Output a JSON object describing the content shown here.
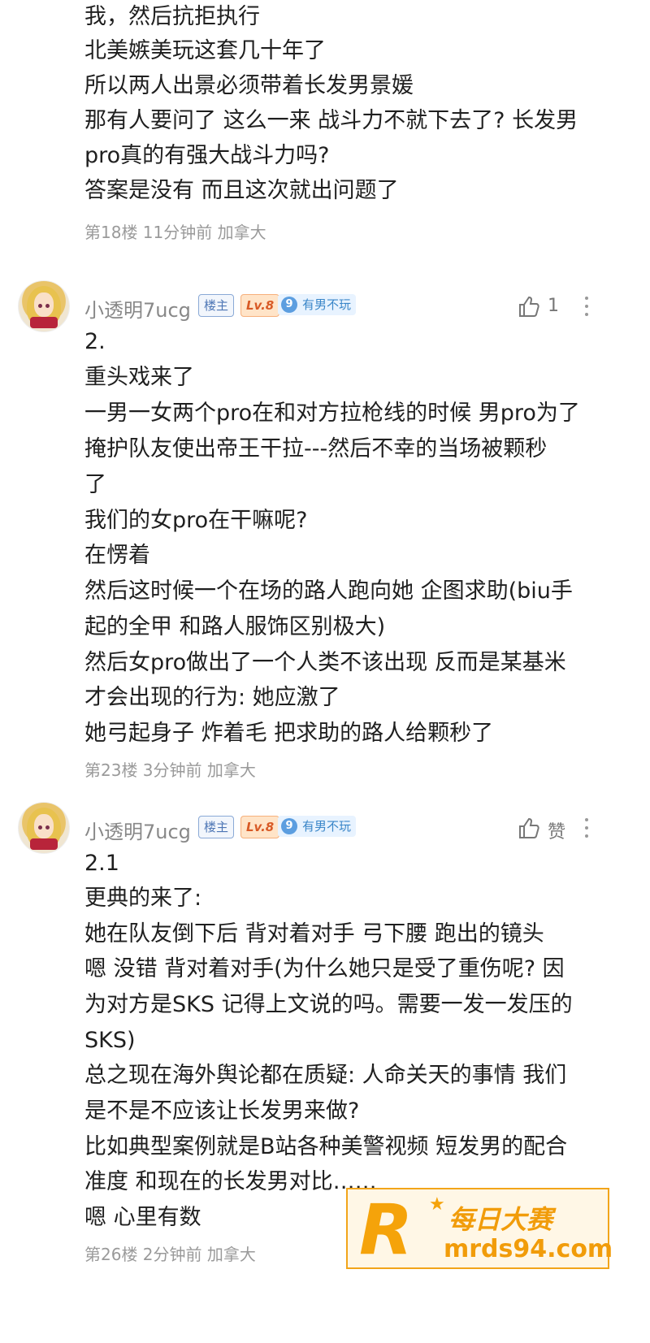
{
  "post1": {
    "lines": [
      "我，然后抗拒执行",
      "北美嫉美玩这套几十年了",
      "所以两人出景必须带着长发男景媛",
      "那有人要问了 这么一来 战斗力不就下去了? 长发男",
      "pro真的有强大战斗力吗?",
      "答案是没有 而且这次就出问题了"
    ],
    "meta": "第18楼  11分钟前  加拿大"
  },
  "post2": {
    "username": "小透明7ucg",
    "badge_owner": "楼主",
    "badge_level": "Lv.8",
    "badge_tag_num": "9",
    "badge_tag": "有男不玩",
    "likes": "1",
    "lines": [
      "2.",
      "重头戏来了",
      "一男一女两个pro在和对方拉枪线的时候 男pro为了",
      "掩护队友使出帝王干拉---然后不幸的当场被颗秒",
      "了",
      "我们的女pro在干嘛呢?",
      "在愣着",
      "然后这时候一个在场的路人跑向她 企图求助(biu手",
      "起的全甲 和路人服饰区别极大)",
      "然后女pro做出了一个人类不该出现 反而是某基米",
      "才会出现的行为: 她应激了",
      "她弓起身子 炸着毛 把求助的路人给颗秒了"
    ],
    "meta": "第23楼  3分钟前  加拿大"
  },
  "post3": {
    "username": "小透明7ucg",
    "badge_owner": "楼主",
    "badge_level": "Lv.8",
    "badge_tag_num": "9",
    "badge_tag": "有男不玩",
    "likes": "赞",
    "lines": [
      "2.1",
      "更典的来了:",
      "她在队友倒下后 背对着对手 弓下腰 跑出的镜头",
      "嗯 没错 背对着对手(为什么她只是受了重伤呢? 因",
      "为对方是SKS 记得上文说的吗。需要一发一发压的",
      "SKS)",
      "总之现在海外舆论都在质疑: 人命关天的事情 我们",
      "是不是不应该让长发男来做?",
      "比如典型案例就是B站各种美警视频 短发男的配合",
      "准度 和现在的长发男对比……",
      "嗯 心里有数"
    ],
    "meta": "第26楼  2分钟前  加拿大"
  },
  "watermark": {
    "logo_letter": "R",
    "star": "★",
    "cn": "每日大赛",
    "url": "mrds94.com"
  }
}
